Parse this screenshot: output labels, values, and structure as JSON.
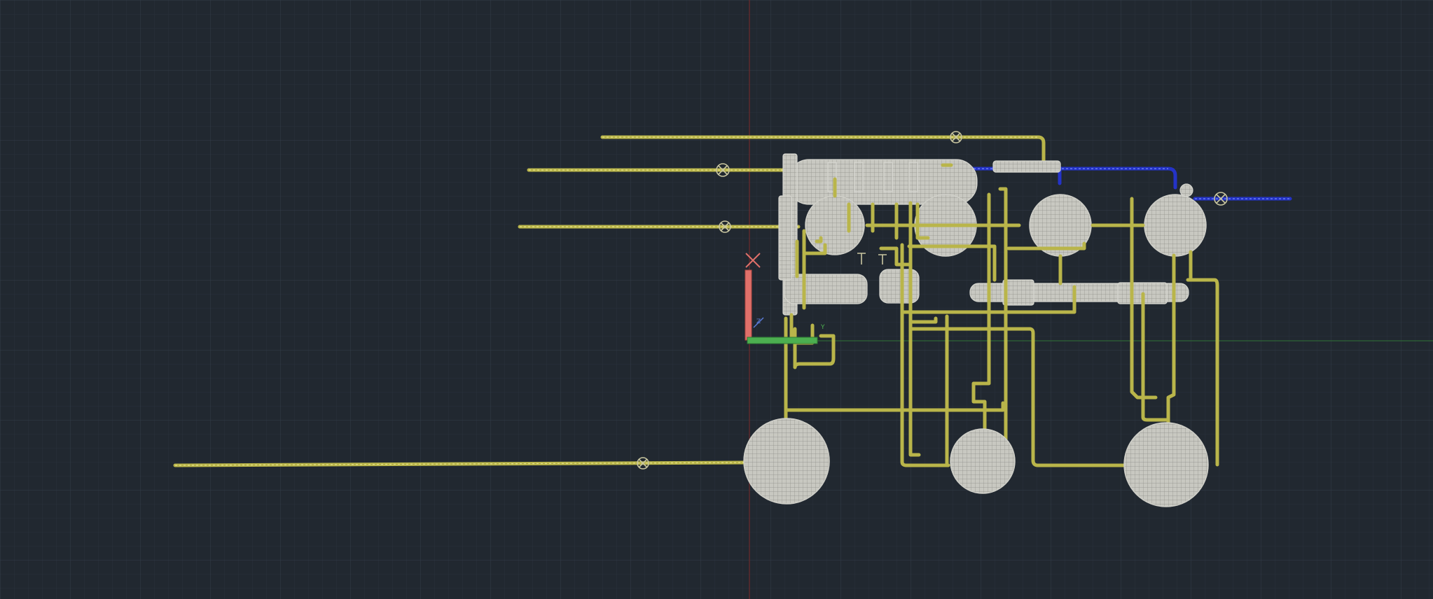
{
  "viewport": {
    "background": "#212830",
    "grid_minor_color": "#29313b",
    "grid_major_color": "#303945",
    "axis_x_color": "#2f7a3a",
    "axis_y_color": "#8a2b2b"
  },
  "ucs_icon": {
    "x_arrow_color": "#4caf50",
    "y_arrow_color": "#e0706a",
    "z_label": "Z",
    "y_label": "Y"
  },
  "model": {
    "pipe_color": "#b9b54a",
    "highlight_pipe_color": "#2433c8",
    "equipment_color": "#c9c9c2"
  }
}
